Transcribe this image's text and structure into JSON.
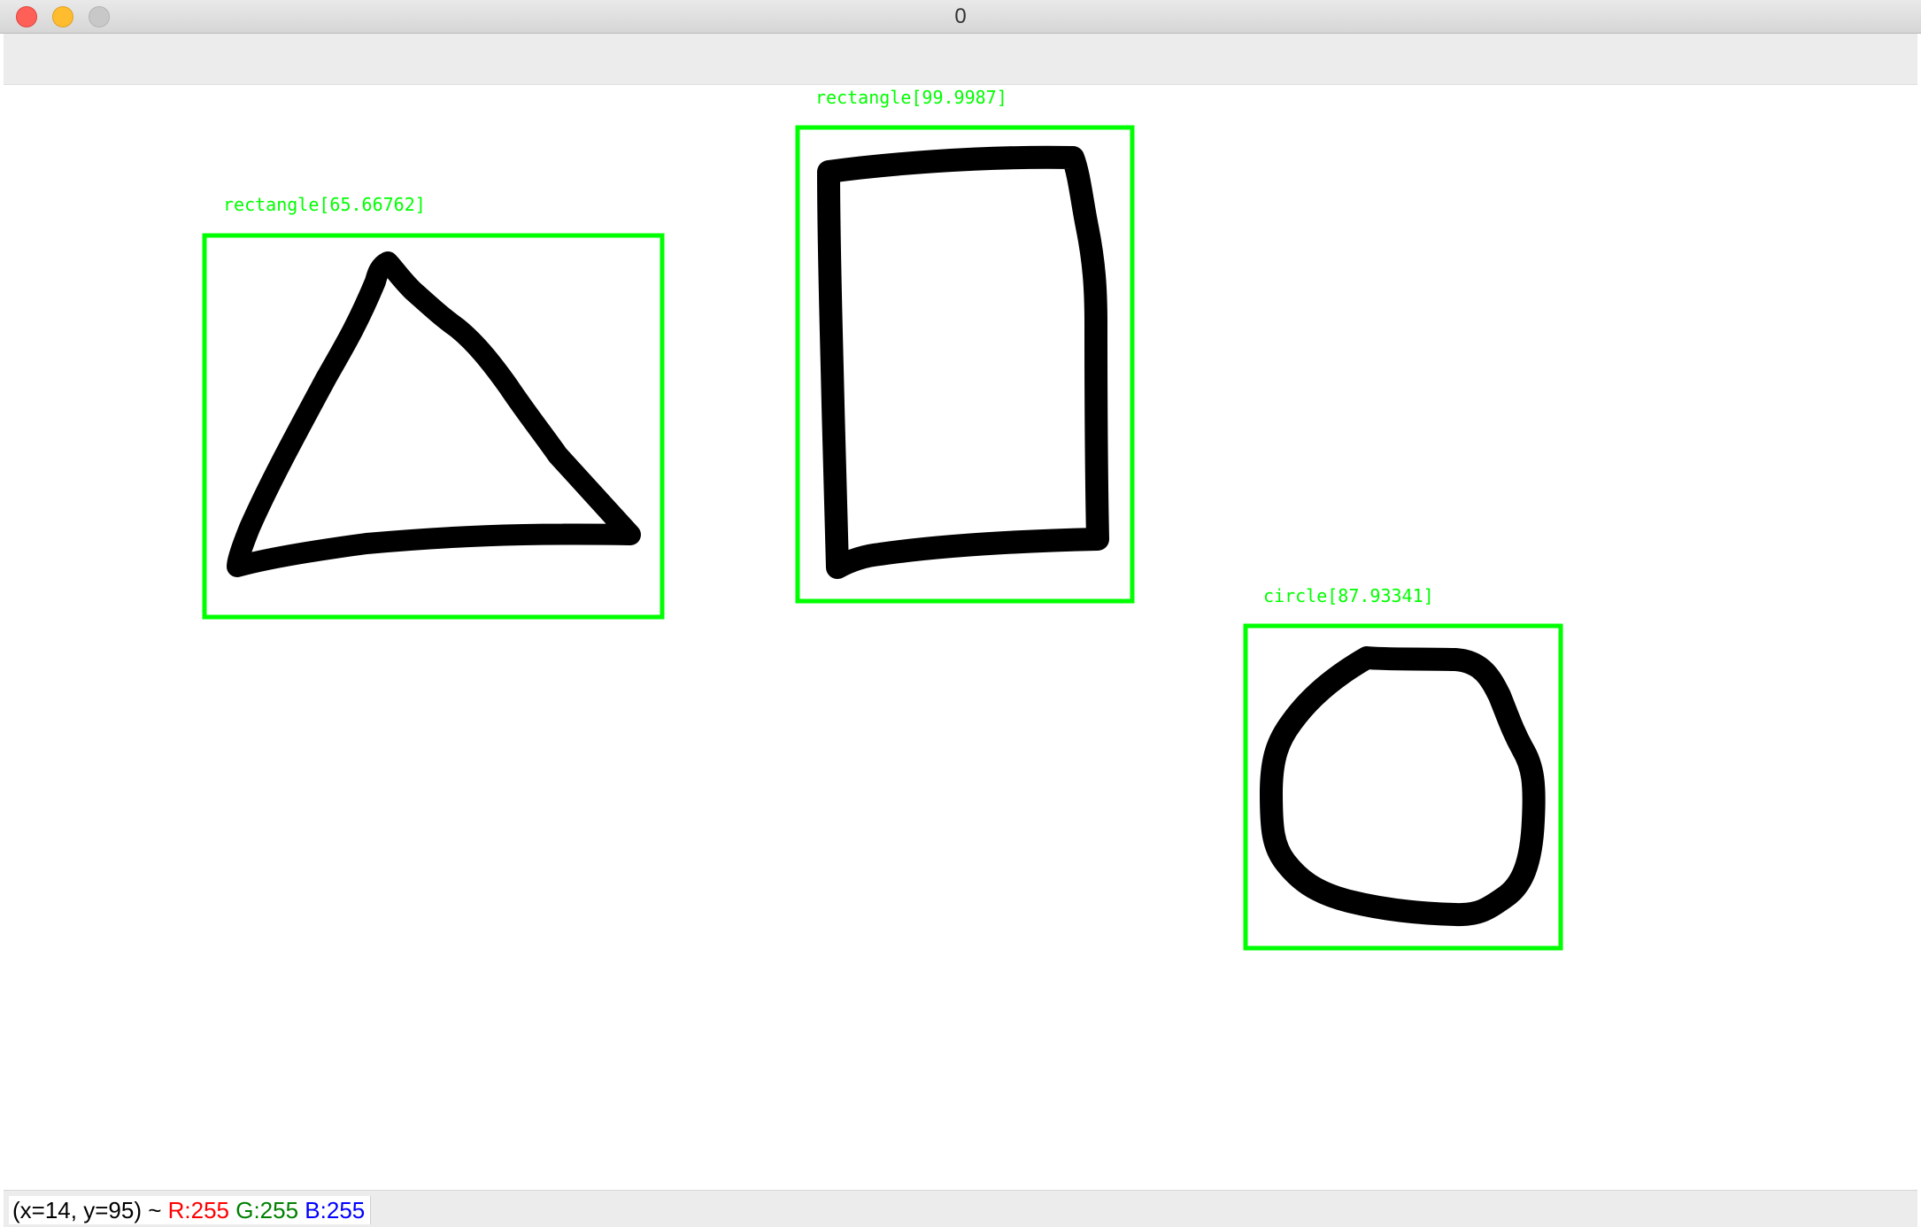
{
  "window": {
    "title": "0"
  },
  "colors": {
    "detection": "#00ff00",
    "stroke": "#000000",
    "red": "#ff0000",
    "green": "#008000",
    "blue": "#0000ff"
  },
  "detections": [
    {
      "label": "rectangle[65.66762]",
      "shape": "triangle"
    },
    {
      "label": "rectangle[99.9987]",
      "shape": "rectangle"
    },
    {
      "label": "circle[87.93341]",
      "shape": "circle"
    }
  ],
  "status": {
    "coords": "(x=14, y=95) ~ ",
    "r": "R:255",
    "g": "G:255",
    "b": "B:255"
  }
}
